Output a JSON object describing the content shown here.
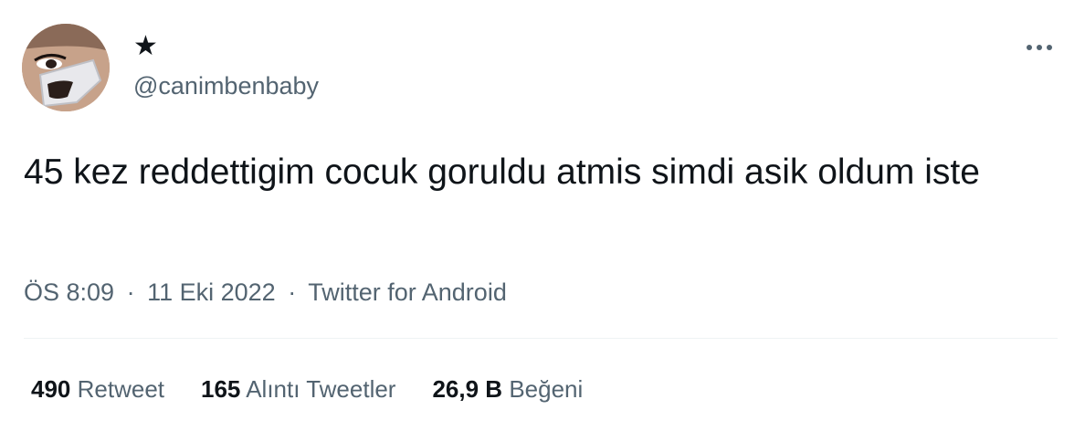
{
  "author": {
    "display_name": "★",
    "handle": "@canimbenbaby"
  },
  "more_icon": "more-horizontal-icon",
  "tweet": {
    "text": "45 kez reddettigim cocuk goruldu atmis simdi asik oldum iste"
  },
  "meta": {
    "time": "ÖS 8:09",
    "separator": "·",
    "date": "11 Eki 2022",
    "source": "Twitter for Android"
  },
  "stats": {
    "retweets_count": "490",
    "retweets_label": "Retweet",
    "quotes_count": "165",
    "quotes_label": "Alıntı Tweetler",
    "likes_count": "26,9 B",
    "likes_label": "Beğeni"
  },
  "colors": {
    "text": "#0f1419",
    "secondary": "#536471",
    "divider": "#eff3f4"
  }
}
